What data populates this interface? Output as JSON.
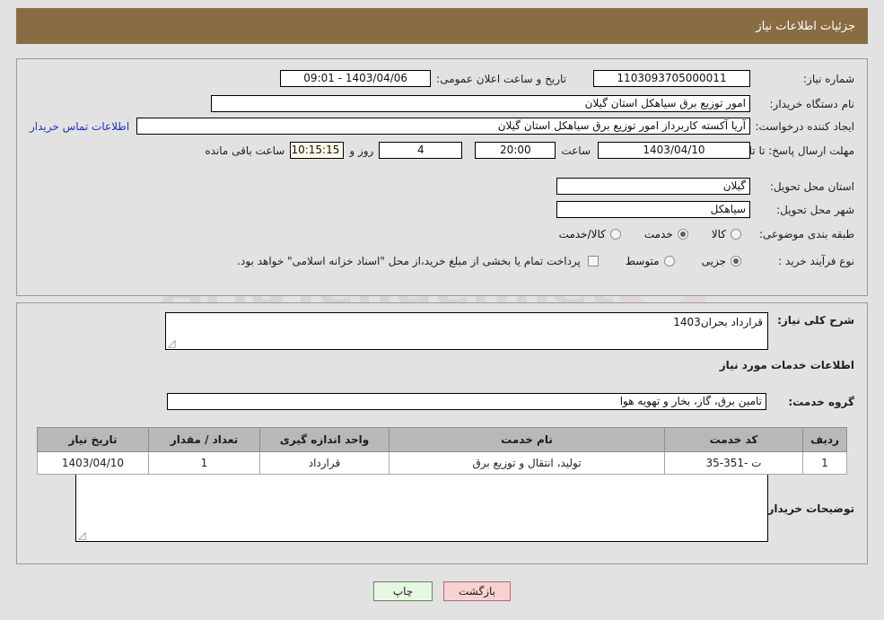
{
  "window": {
    "title": "جزئیات اطلاعات نیاز",
    "header_bg": "#8a6c43"
  },
  "watermark": {
    "text": "AriaTender.net"
  },
  "top_panel": {
    "need_number": {
      "label": "شماره نیاز:",
      "value": "1103093705000011"
    },
    "announce_datetime": {
      "label": "تاریخ و ساعت اعلان عمومی:",
      "value": "1403/04/06 - 09:01"
    },
    "buyer_org": {
      "label": "نام دستگاه خریدار:",
      "value": "امور توزیع برق سیاهکل استان گیلان"
    },
    "request_creator": {
      "label": "ایجاد کننده درخواست:",
      "value": "آریا آکسته کاربرداز امور توزیع برق سیاهکل استان گیلان"
    },
    "contact_link": "اطلاعات تماس خریدار",
    "deadline": {
      "label": "مهلت ارسال پاسخ: تا تاریخ:",
      "date": "1403/04/10",
      "hour_label": "ساعت",
      "hour": "20:00",
      "days": "4",
      "days_label": "روز و",
      "countdown": "10:15:15",
      "remaining_label": "ساعت باقی مانده"
    },
    "delivery_province": {
      "label": "استان محل تحویل:",
      "value": "گیلان"
    },
    "delivery_city": {
      "label": "شهر محل تحویل:",
      "value": "سیاهکل"
    },
    "subject_category": {
      "label": "طبقه بندی موضوعی:",
      "options": [
        {
          "text": "کالا",
          "selected": false
        },
        {
          "text": "خدمت",
          "selected": true
        },
        {
          "text": "کالا/خدمت",
          "selected": false
        }
      ]
    },
    "purchase_process": {
      "label": "نوع فرآیند خرید :",
      "options": [
        {
          "text": "جزیی",
          "selected": true
        },
        {
          "text": "متوسط",
          "selected": false
        }
      ],
      "checkbox_checked": false,
      "note": "پرداخت تمام یا بخشی از مبلغ خرید،از محل \"اسناد خزانه اسلامی\" خواهد بود."
    }
  },
  "bottom_panel": {
    "general_description": {
      "label": "شرح کلی نیاز:",
      "value": "قرارداد بحران1403"
    },
    "services_section_title": "اطلاعات خدمات مورد نیاز",
    "service_group": {
      "label": "گروه خدمت:",
      "value": "تامین برق، گاز، بخار و تهویه هوا"
    },
    "table": {
      "columns": [
        "ردیف",
        "کد خدمت",
        "نام خدمت",
        "واحد اندازه گیری",
        "تعداد / مقدار",
        "تاریخ نیاز"
      ],
      "rows": [
        [
          "1",
          "ت -351-35",
          "تولید، انتقال و توزیع برق",
          "قرارداد",
          "1",
          "1403/04/10"
        ]
      ]
    },
    "buyer_notes": {
      "label": "توضیحات خریدار:",
      "value": ""
    }
  },
  "footer": {
    "print_label": "چاپ",
    "back_label": "بازگشت"
  }
}
